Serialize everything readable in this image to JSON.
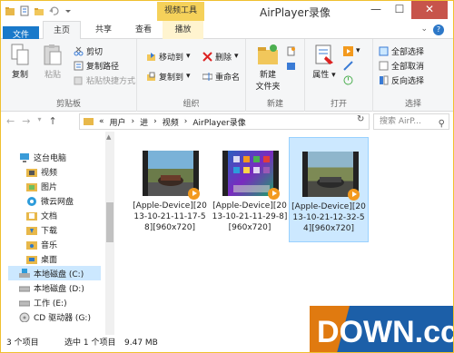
{
  "title_bar": {
    "context_tab_group": "视频工具",
    "window_title": "AirPlayer录像",
    "minimize": "—",
    "maximize": "☐",
    "close": "✕"
  },
  "tabs": [
    {
      "label": "文件"
    },
    {
      "label": "主页"
    },
    {
      "label": "共享"
    },
    {
      "label": "查看"
    },
    {
      "label": "播放"
    }
  ],
  "ribbon": {
    "clipboard": {
      "label": "剪贴板",
      "copy": "复制",
      "paste": "粘贴",
      "cut": "剪切",
      "copy_path": "复制路径",
      "paste_shortcut": "粘贴快捷方式"
    },
    "organize": {
      "label": "组织",
      "move_to": "移动到",
      "copy_to": "复制到",
      "delete": "删除",
      "rename": "重命名"
    },
    "new": {
      "label": "新建",
      "new_folder_line1": "新建",
      "new_folder_line2": "文件夹"
    },
    "open": {
      "label": "打开",
      "properties": "属性"
    },
    "select": {
      "label": "选择",
      "select_all": "全部选择",
      "select_none": "全部取消",
      "invert": "反向选择"
    }
  },
  "address_bar": {
    "prefix": "«",
    "path": [
      "用户",
      "进",
      "视频",
      "AirPlayer录像"
    ],
    "search_placeholder": "搜索 AirP..."
  },
  "nav_pane": {
    "items": [
      {
        "label": "这台电脑"
      },
      {
        "label": "视频"
      },
      {
        "label": "图片"
      },
      {
        "label": "微云网盘"
      },
      {
        "label": "文档"
      },
      {
        "label": "下载"
      },
      {
        "label": "音乐"
      },
      {
        "label": "桌面"
      },
      {
        "label": "本地磁盘 (C:)"
      },
      {
        "label": "本地磁盘 (D:)"
      },
      {
        "label": "工作 (E:)"
      },
      {
        "label": "CD 驱动器 (G:)"
      }
    ]
  },
  "files": [
    {
      "name": "[Apple-Device][2013-10-21-11-17-58][960x720]"
    },
    {
      "name": "[Apple-Device][2013-10-21-11-29-8][960x720]"
    },
    {
      "name": "[Apple-Device][2013-10-21-12-32-54][960x720]"
    }
  ],
  "status_bar": {
    "item_count": "3 个项目",
    "selected": "选中 1 个项目",
    "size": "9.47 MB"
  },
  "watermark": "DOWN.cc",
  "colors": {
    "file_tab": "#1979ca",
    "context_tab": "#f5d15a",
    "selection": "#cce8ff",
    "close_button": "#c7544b"
  }
}
